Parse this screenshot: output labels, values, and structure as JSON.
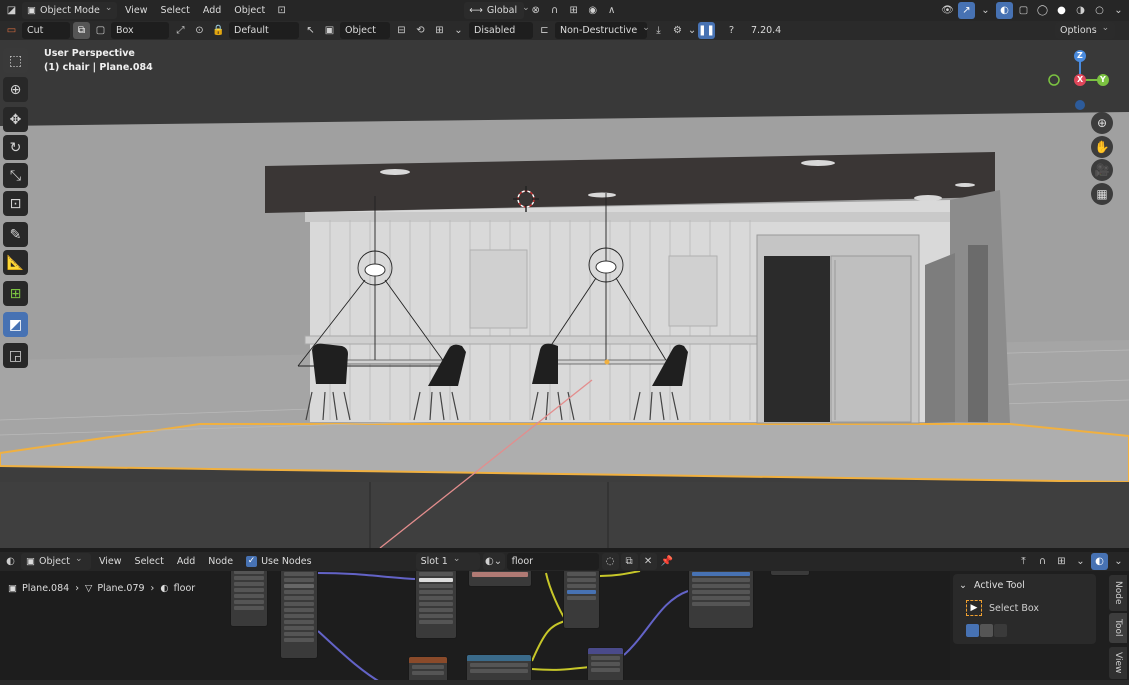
{
  "top_header": {
    "mode_label": "Object Mode",
    "menus": [
      "View",
      "Select",
      "Add",
      "Object"
    ],
    "orientation": "Global"
  },
  "tool_header": {
    "operation": "Cut",
    "shape": "Box",
    "material_mode": "Default",
    "target": "Object",
    "snap": "Disabled",
    "mode": "Non-Destructive",
    "version": "7.20.4",
    "options_label": "Options"
  },
  "viewport": {
    "perspective_label": "User Perspective",
    "object_info": "(1) chair | Plane.084",
    "gizmo": {
      "z": "Z",
      "x": "X",
      "y": "Y"
    }
  },
  "node_header": {
    "editor_type": "Object",
    "menus": [
      "View",
      "Select",
      "Add",
      "Node"
    ],
    "use_nodes_label": "Use Nodes",
    "use_nodes_checked": true,
    "slot": "Slot 1",
    "material_name": "floor"
  },
  "breadcrumb": {
    "items": [
      "Plane.084",
      "Plane.079",
      "floor"
    ]
  },
  "node_sidebar": {
    "title": "Active Tool",
    "tool_name": "Select Box",
    "tabs": [
      "Node",
      "Tool",
      "View"
    ]
  },
  "colors": {
    "accent": "#4772b3",
    "selection_outline": "#f0b040",
    "x_axis": "#e0475a",
    "y_axis": "#7bc241",
    "z_axis": "#4a8bde"
  }
}
